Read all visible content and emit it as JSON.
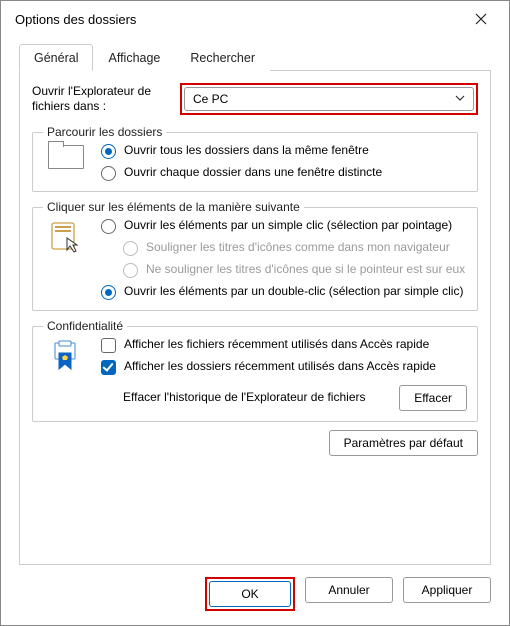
{
  "window": {
    "title": "Options des dossiers"
  },
  "tabs": {
    "general": "Général",
    "display": "Affichage",
    "search": "Rechercher"
  },
  "openIn": {
    "label": "Ouvrir l'Explorateur de fichiers dans :",
    "selected": "Ce PC"
  },
  "browse": {
    "legend": "Parcourir les dossiers",
    "openSame": "Ouvrir tous les dossiers dans la même fenêtre",
    "openNew": "Ouvrir chaque dossier dans une fenêtre distincte"
  },
  "click": {
    "legend": "Cliquer sur les éléments de la manière suivante",
    "single": "Ouvrir les éléments par un simple clic (sélection par pointage)",
    "underlineBrowser": "Souligner les titres d'icônes comme dans mon navigateur",
    "underlineHover": "Ne souligner les titres d'icônes que si le pointeur est sur eux",
    "double": "Ouvrir les éléments par un double-clic (sélection par simple clic)"
  },
  "privacy": {
    "legend": "Confidentialité",
    "recentFiles": "Afficher les fichiers récemment utilisés dans Accès rapide",
    "recentFolders": "Afficher les dossiers récemment utilisés dans Accès rapide",
    "clearLabel": "Effacer l'historique de l'Explorateur de fichiers",
    "clearBtn": "Effacer"
  },
  "defaultsBtn": "Paramètres par défaut",
  "footer": {
    "ok": "OK",
    "cancel": "Annuler",
    "apply": "Appliquer"
  }
}
